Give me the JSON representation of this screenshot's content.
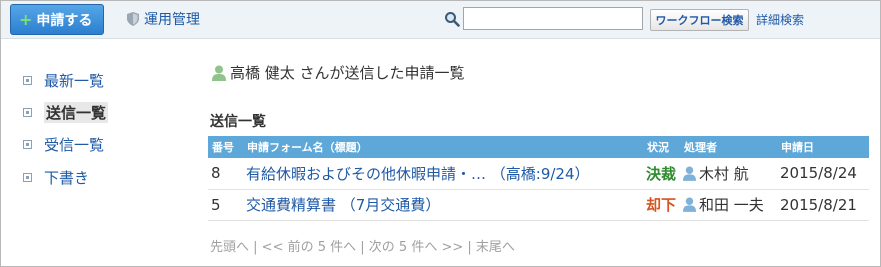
{
  "toolbar": {
    "new_request": "申請する",
    "admin": "運用管理",
    "search_value": "",
    "workflow_search": "ワークフロー検索",
    "advanced_search": "詳細検索"
  },
  "sidebar": {
    "items": [
      {
        "label": "最新一覧",
        "active": false
      },
      {
        "label": "送信一覧",
        "active": true
      },
      {
        "label": "受信一覧",
        "active": false
      },
      {
        "label": "下書き",
        "active": false
      }
    ]
  },
  "main": {
    "heading": "高橋 健太 さんが送信した申請一覧",
    "section_title": "送信一覧",
    "columns": [
      "番号",
      "申請フォーム名（標題）",
      "状況",
      "処理者",
      "申請日"
    ],
    "rows": [
      {
        "no": "8",
        "form": "有給休暇およびその他休暇申請・… （高橋:9/24）",
        "status": "決裁",
        "status_color": "#2e8b2e",
        "handler": "木村 航",
        "date": "2015/8/24"
      },
      {
        "no": "5",
        "form": "交通費精算書 （7月交通費）",
        "status": "却下",
        "status_color": "#d9531e",
        "handler": "和田 一夫",
        "date": "2015/8/21"
      }
    ],
    "pager": {
      "first": "先頭へ",
      "sep1": " | ",
      "prev": "<< 前の 5 件へ",
      "sep2": " | ",
      "next": "次の 5 件へ >>",
      "sep3": " | ",
      "last": "末尾へ"
    }
  },
  "colors": {
    "accent": "#1f5aa6",
    "table_header": "#5da7d9",
    "approved": "#2e8b2e",
    "rejected": "#d9531e"
  },
  "icons": [
    "plus-icon",
    "shield-icon",
    "search-icon",
    "user-icon"
  ]
}
